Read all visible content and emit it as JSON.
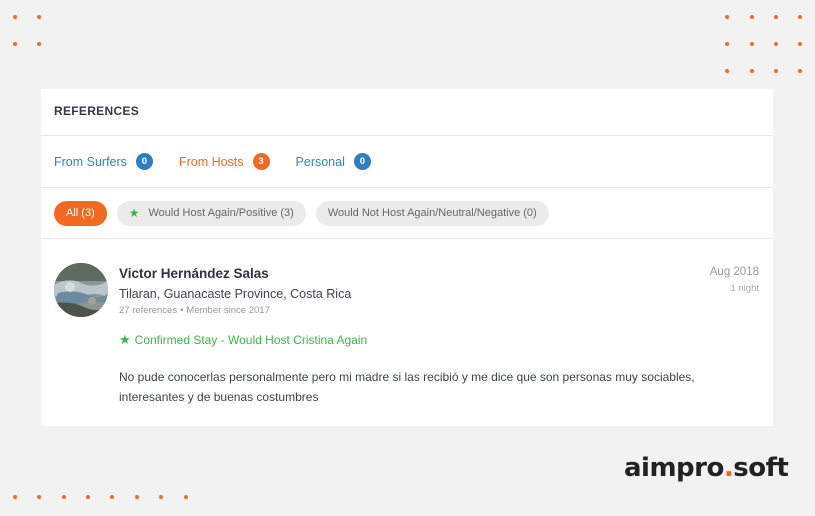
{
  "card": {
    "title": "REFERENCES"
  },
  "tabs": [
    {
      "label": "From Surfers",
      "count": "0",
      "active": false
    },
    {
      "label": "From Hosts",
      "count": "3",
      "active": true
    },
    {
      "label": "Personal",
      "count": "0",
      "active": false
    }
  ],
  "filters": [
    {
      "label": "All (3)",
      "active": true,
      "icon": ""
    },
    {
      "label": "Would Host Again/Positive (3)",
      "active": false,
      "icon": "star-icon"
    },
    {
      "label": "Would Not Host Again/Neutral/Negative (0)",
      "active": false,
      "icon": ""
    }
  ],
  "reference": {
    "name": "Victor Hernández Salas",
    "location": "Tilaran, Guanacaste Province, Costa Rica",
    "references": "27 references",
    "separator": "•",
    "member_since": "Member since 2017",
    "confirmed": "Confirmed Stay - Would Host Cristina Again",
    "text": "No pude conocerlas personalmente pero mi madre si las recibió y me dice que son personas muy sociables, interesantes y de buenas costumbres",
    "date": "Aug 2018",
    "nights": "1 night"
  },
  "brand": {
    "name_left": "aimpro",
    "dot": ".",
    "name_right": "soft"
  },
  "colors": {
    "accent": "#f26a21",
    "link": "#2f87c0",
    "positive": "#3cb54a"
  }
}
